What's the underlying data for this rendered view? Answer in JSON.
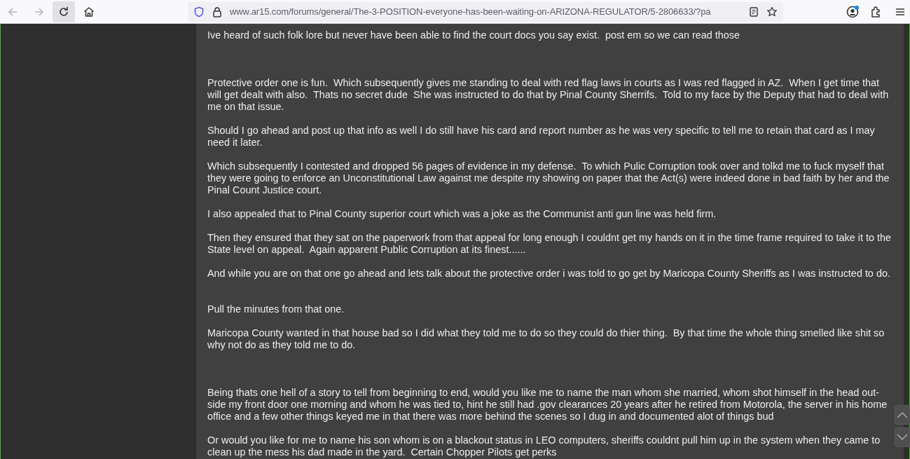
{
  "toolbar": {
    "buttons": [
      {
        "kind": "back",
        "disabled": true
      },
      {
        "kind": "forward",
        "disabled": true
      },
      {
        "kind": "reload",
        "disabled": false
      },
      {
        "kind": "home",
        "disabled": false
      }
    ],
    "address": {
      "url": "www.ar15.com/forums/general/The-3-POSITION-everyone-has-been-waiting-on-ARIZONA-REGULATOR/5-2806633/?pa"
    }
  },
  "post": {
    "paragraphs": [
      {
        "text": "Ive heard of such folk lore but never have been able to find the court docs you say exist.  post em so we can read those"
      },
      {
        "text": "Protective order one is fun.  Which subsequently gives me standing to deal with red flag laws in courts as I was red flagged in AZ.  When I get time that will get dealt with also.  Thats no secret dude  She was instructed to do that by Pinal County Sherrifs.  Told to my face by the Deputy that had to deal with me on that issue."
      },
      {
        "text": "Should I go ahead and post up that info as well I do still have his card and report number as he was very specific to tell me to retain that card as I may need it later."
      },
      {
        "text": "Which subsequently I contested and dropped 56 pages of evidence in my defense.  To which Pulic Corruption took over and tolkd me to fuck myself that they were going to enforce an Unconstitutional Law against me despite my showing on paper that the Act(s) were indeed done in bad faith by her and the Pinal Count Justice court."
      },
      {
        "text": "I also appealed that to Pinal County superior court which was a joke as the Communist anti gun line was held firm."
      },
      {
        "text": "Then they ensured that they sat on the paperwork from that appeal for long enough I couldnt get my hands on it in the time frame required to take it to the State level on appeal.  Again apparent Public Corruption at its finest......"
      },
      {
        "text": "And while you are on that one go ahead and lets talk about the protective order i was told to go get by Maricopa County Sheriffs as I was instructed to do."
      },
      {
        "text": "Pull the minutes from that one."
      },
      {
        "text": "Maricopa County wanted in that house bad so I did what they told me to do so they could do thier thing.  By that time the whole thing smelled like shit so why not do as they told me to do."
      },
      {
        "text": "Being thats one hell of a story to tell from beginning to end, would you like me to name the man whom she married, whom shot himself in the head out-side my front door one morning and whom he was tied to, hint he still had .gov clearances 20 years after he retired from Motorola, the server in his home office and a few other things keyed me in that there was more behind the scenes so I dug in and documented alot of things bud"
      },
      {
        "text": "Or would you like for me to name his son whom is on a blackout status in LEO computers, sheriffs couldnt pull him up in the system when they came to clean up the mess his dad made in the yard.  Certain Chopper Pilots get perks"
      }
    ]
  }
}
